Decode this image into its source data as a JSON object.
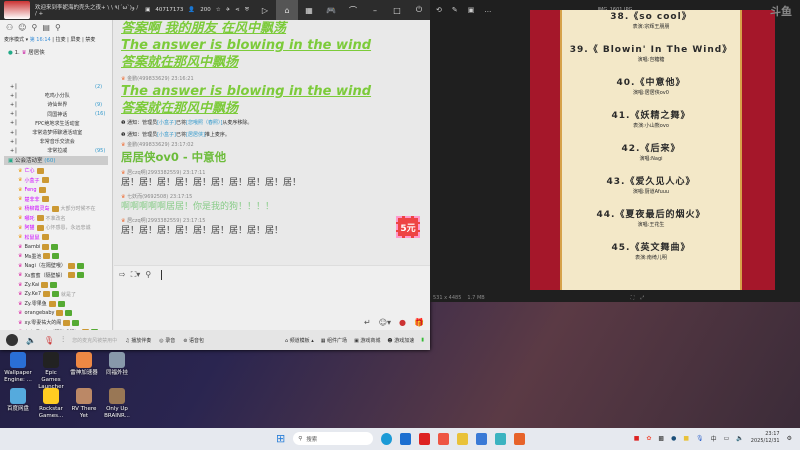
{
  "app": {
    "title": "欢迎来到李妮海的壳头之夜+ \\ \\ ٩(ˊωˋ)و / / +",
    "room_id": "40717173",
    "online": "200",
    "sidebar": {
      "mode": "麦序模式 ▾",
      "time": "第 16:14",
      "actions": [
        "拉麦",
        "屏麦",
        "禁麦"
      ],
      "first": "1.",
      "first_name": "居居侠",
      "channels": [
        {
          "name": "",
          "count": "(2)"
        },
        {
          "name": "吃鸡小分队",
          "count": ""
        },
        {
          "name": "诗仙世界",
          "count": "(9)"
        },
        {
          "name": "同国神话",
          "count": "(16)"
        },
        {
          "name": "FPC绝地求生活动室",
          "count": ""
        },
        {
          "name": "非常造梦师聊通活动室",
          "count": ""
        },
        {
          "name": "非常音乐交流会",
          "count": ""
        },
        {
          "name": "非常拉戚",
          "count": "(95)"
        }
      ],
      "guild": "公会活动室",
      "guild_count": "(60)",
      "members": [
        {
          "name": "亡心",
          "note": ""
        },
        {
          "name": "小盒子",
          "note": ""
        },
        {
          "name": "Feng",
          "note": ""
        },
        {
          "name": "楚非非",
          "note": ""
        },
        {
          "name": "杨柳霞灵岛",
          "note": "大部分时候不在"
        },
        {
          "name": "哪吒",
          "note": "不准改名"
        },
        {
          "name": "阿猫",
          "note": "心怀感恩，永远忠诚"
        },
        {
          "name": "松鼠鼠",
          "note": ""
        },
        {
          "name": "Bambi",
          "note": ""
        },
        {
          "name": "Ms墨池",
          "note": ""
        },
        {
          "name": "Nagi（在隔壁哦）",
          "note": ""
        },
        {
          "name": "Xs蜜蜜（隔壁躲）",
          "note": ""
        },
        {
          "name": "Zy.Kai",
          "note": ""
        },
        {
          "name": "Zy.Ke7",
          "note": "就是了"
        },
        {
          "name": "Zy.零果鱼",
          "note": ""
        },
        {
          "name": "orangebaby",
          "note": ""
        },
        {
          "name": "xy.零妻祐大的阁",
          "note": ""
        },
        {
          "name": "七七吓七七（隔壁恐服）",
          "note": ""
        }
      ]
    },
    "chat": {
      "lines_top": [
        "答案啊 我的朋友 在风中飘荡",
        "The answer is blowing in the wind",
        "答案就在那风中飘扬"
      ],
      "msg1": {
        "meta": "金鹏(499833629)  23:16:21",
        "lines": [
          "The answer is blowing in the wind",
          "答案就在那风中飘扬"
        ]
      },
      "notice1": {
        "pre": "通知：管理员",
        "admin": "[小盒子]",
        "mid": "已将",
        "user": "[您哦照（春照）]",
        "post": "从麦序移除。"
      },
      "notice2": {
        "pre": "通知：管理员",
        "admin": "[小盒子]",
        "mid": "已将",
        "user": "[居居侠]",
        "post": "推上麦序。"
      },
      "msg2": {
        "meta": "金鹏(499833629)  23:17:02",
        "text": "居居侠ov0 - 中意他"
      },
      "msg3": {
        "meta": "居czq啊(2993382559)  23:17:11",
        "text": "居！居！居！居！居！居！居！居！居！居！"
      },
      "msg4": {
        "meta": "七妖而(9692508)  23:17:15",
        "text": "啊啊啊啊啊居居！你是我的狗！！！！"
      },
      "msg5": {
        "meta": "居czq啊(2993382559)  23:17:15",
        "text": "居！居！居！居！居！居！居！居！居！"
      },
      "redpacket": "5元"
    },
    "bottom": {
      "mic_hint": "您的麦克风被禁用中",
      "items": [
        "播放伴奏",
        "录音",
        "语音包"
      ],
      "right": [
        "频道模板 ▴",
        "组件广场",
        "游戏商城",
        "游戏加速"
      ]
    }
  },
  "viewer": {
    "filename": "IMG_1601.JPG",
    "dims": "531 x 4485",
    "size": "1.7 MB",
    "watermark": "斗鱼",
    "songs": [
      {
        "title": "38.《so cool》",
        "perf": "表演:宗辉王朋朋"
      },
      {
        "title": "39.《 Blowin' In The Wind》",
        "perf": "演唱:岂糖糖"
      },
      {
        "title": "40.《中意他》",
        "perf": "演唱:居居侠ov0"
      },
      {
        "title": "41.《妖精之舞》",
        "perf": "表演:小山熊ovo"
      },
      {
        "title": "42.《后来》",
        "perf": "演唱:Nagi"
      },
      {
        "title": "43.《爱久见人心》",
        "perf": "演唱:厨道Afuuu"
      },
      {
        "title": "44.《夏夜最后的烟火》",
        "perf": "演唱:王花生"
      },
      {
        "title": "45.《英文舞曲》",
        "perf": "表演:南绮儿明"
      }
    ]
  },
  "desktop": [
    {
      "label": "Wallpaper Engine: ...",
      "color": "#2a6fd6"
    },
    {
      "label": "Epic Games Launcher",
      "color": "#222"
    },
    {
      "label": "雷神加速器",
      "color": "#e84"
    },
    {
      "label": "同福外挂",
      "color": "#89a"
    },
    {
      "label": "百度网盘",
      "color": "#5ad"
    },
    {
      "label": "Rockstar Games...",
      "color": "#fc2"
    },
    {
      "label": "RV There Yet",
      "color": "#b86"
    },
    {
      "label": "Only Up BRAINR...",
      "color": "#975"
    }
  ],
  "taskbar": {
    "search": "搜索",
    "ime": "中",
    "time": "23:17",
    "date": "2025/12/31"
  }
}
